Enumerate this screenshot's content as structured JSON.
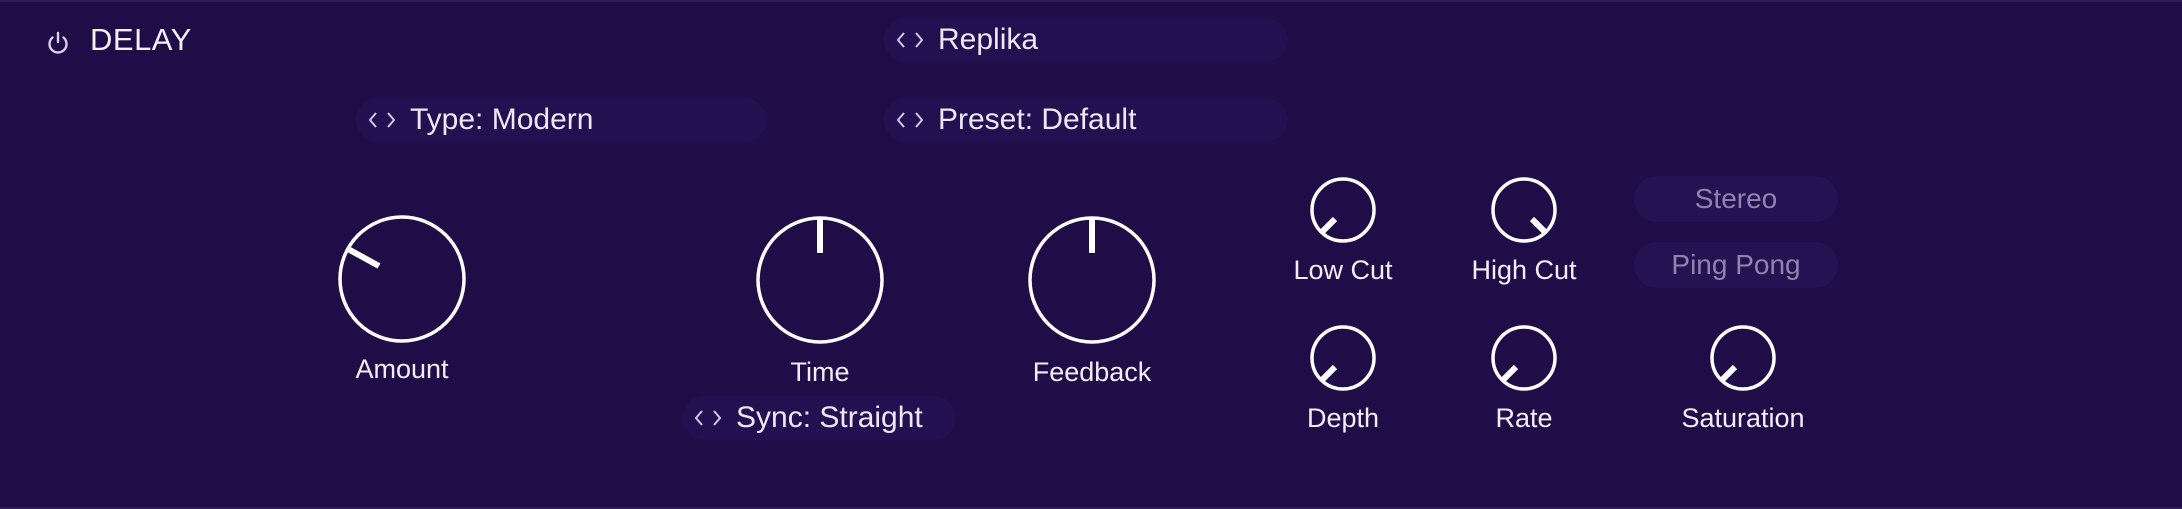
{
  "header": {
    "title": "DELAY",
    "power_icon": "power-icon"
  },
  "plugin_selector": {
    "label": "Replika"
  },
  "type_selector": {
    "label": "Type: Modern"
  },
  "preset_selector": {
    "label": "Preset: Default"
  },
  "sync_selector": {
    "label": "Sync: Straight"
  },
  "knobs": {
    "amount": {
      "label": "Amount"
    },
    "time": {
      "label": "Time"
    },
    "feedback": {
      "label": "Feedback"
    },
    "low_cut": {
      "label": "Low Cut"
    },
    "high_cut": {
      "label": "High Cut"
    },
    "depth": {
      "label": "Depth"
    },
    "rate": {
      "label": "Rate"
    },
    "saturation": {
      "label": "Saturation"
    }
  },
  "mode_toggles": {
    "stereo": "Stereo",
    "ping_pong": "Ping Pong"
  },
  "colors": {
    "background": "#200d47",
    "pill": "#231050",
    "knob_stroke": "#ffffff",
    "muted_text": "#8f84ac"
  }
}
